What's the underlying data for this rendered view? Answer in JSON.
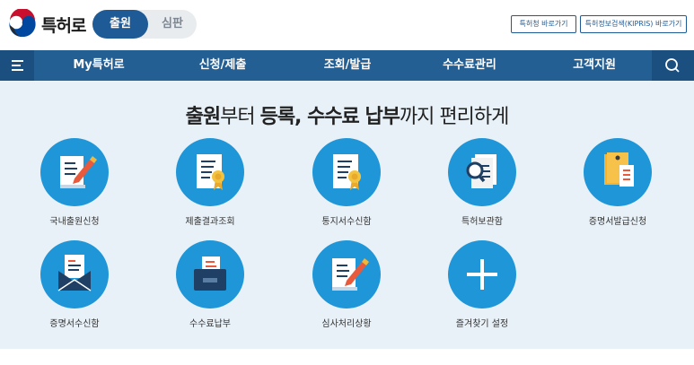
{
  "header": {
    "brand": "특허로",
    "segments": {
      "active": "출원",
      "inactive": "심판"
    },
    "links": [
      "특허청 바로가기",
      "특허정보검색(KIPRIS) 바로가기"
    ]
  },
  "nav": {
    "items": [
      "My특허로",
      "신청/제출",
      "조회/발급",
      "수수료관리",
      "고객지원"
    ]
  },
  "main": {
    "headline_bold1": "출원",
    "headline_mid1": "부터 ",
    "headline_bold2": "등록, 수수료 납부",
    "headline_mid2": "까지 편리하게",
    "services": [
      {
        "label": "국내출원신청",
        "icon": "edit-document-icon"
      },
      {
        "label": "제출결과조회",
        "icon": "certificate-document-icon"
      },
      {
        "label": "통지서수신함",
        "icon": "notice-document-icon"
      },
      {
        "label": "특허보관함",
        "icon": "magnifier-document-icon"
      },
      {
        "label": "증명서발급신청",
        "icon": "folder-document-icon"
      },
      {
        "label": "증명서수신함",
        "icon": "envelope-document-icon"
      },
      {
        "label": "수수료납부",
        "icon": "payment-box-icon"
      },
      {
        "label": "심사처리상황",
        "icon": "edit-document-icon"
      },
      {
        "label": "즐겨찾기 설정",
        "icon": "plus-icon"
      }
    ]
  },
  "colors": {
    "primary": "#1e5a96",
    "nav": "#245f94",
    "icon_circle": "#1f96d8",
    "background": "#e8f1f8"
  }
}
